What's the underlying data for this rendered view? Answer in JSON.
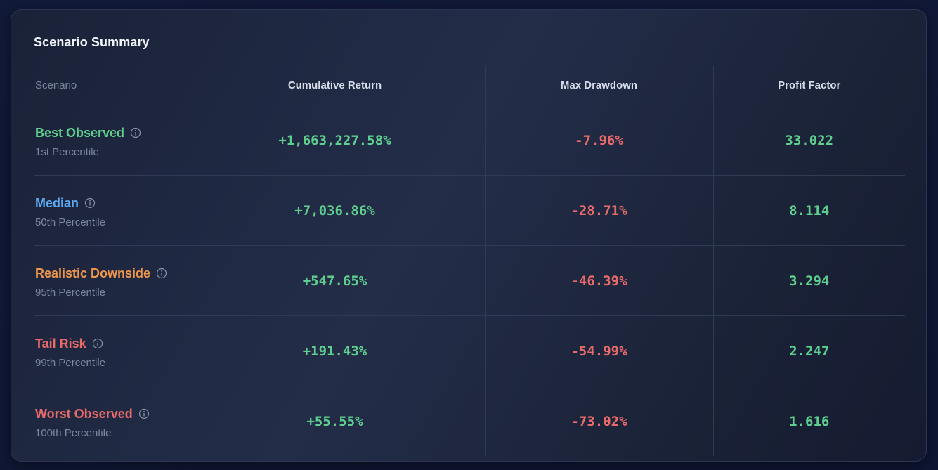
{
  "title": "Scenario Summary",
  "columns": [
    "Scenario",
    "Cumulative Return",
    "Max Drawdown",
    "Profit Factor"
  ],
  "icon": "info-icon",
  "colors": {
    "green": "#5ecf8e",
    "red": "#e86a6a",
    "blue": "#5aa9f2",
    "orange": "#f0964a"
  },
  "rows": [
    {
      "name": "Best Observed",
      "subtitle": "1st Percentile",
      "name_color": "#5ecf8e",
      "cumulative_return": "+1,663,227.58%",
      "max_drawdown": "-7.96%",
      "profit_factor": "33.022"
    },
    {
      "name": "Median",
      "subtitle": "50th Percentile",
      "name_color": "#5aa9f2",
      "cumulative_return": "+7,036.86%",
      "max_drawdown": "-28.71%",
      "profit_factor": "8.114"
    },
    {
      "name": "Realistic Downside",
      "subtitle": "95th Percentile",
      "name_color": "#f0964a",
      "cumulative_return": "+547.65%",
      "max_drawdown": "-46.39%",
      "profit_factor": "3.294"
    },
    {
      "name": "Tail Risk",
      "subtitle": "99th Percentile",
      "name_color": "#e86a6a",
      "cumulative_return": "+191.43%",
      "max_drawdown": "-54.99%",
      "profit_factor": "2.247"
    },
    {
      "name": "Worst Observed",
      "subtitle": "100th Percentile",
      "name_color": "#e86a6a",
      "cumulative_return": "+55.55%",
      "max_drawdown": "-73.02%",
      "profit_factor": "1.616"
    }
  ]
}
